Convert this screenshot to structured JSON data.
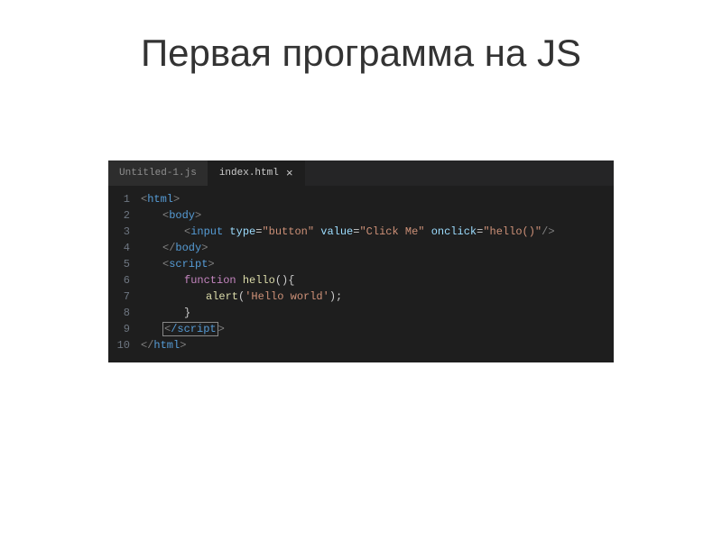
{
  "slide": {
    "title": "Первая программа на JS"
  },
  "editor": {
    "tabs": [
      {
        "label": "Untitled-1.js",
        "active": false
      },
      {
        "label": "index.html",
        "active": true
      }
    ],
    "close_glyph": "×",
    "line_numbers": [
      "1",
      "2",
      "3",
      "4",
      "5",
      "6",
      "7",
      "8",
      "9",
      "10"
    ],
    "code": {
      "l1": {
        "open": "<",
        "tag": "html",
        "close": ">"
      },
      "l2": {
        "open": "<",
        "tag": "body",
        "close": ">"
      },
      "l3": {
        "open": "<",
        "tag": "input",
        "attr1": "type",
        "val1": "\"button\"",
        "attr2": "value",
        "val2": "\"Click Me\"",
        "attr3": "onclick",
        "val3": "\"hello()\"",
        "close": "/>"
      },
      "l4": {
        "open": "</",
        "tag": "body",
        "close": ">"
      },
      "l5": {
        "open": "<",
        "tag": "script",
        "close": ">"
      },
      "l6": {
        "kw": "function",
        "fn": "hello",
        "rest": "(){"
      },
      "l7": {
        "fn": "alert",
        "paren_open": "(",
        "str": "'Hello world'",
        "paren_close": ");"
      },
      "l8": {
        "brace": "}"
      },
      "l9": {
        "open": "<",
        "slash_tag": "/script",
        "close": ">"
      },
      "l10": {
        "open": "</",
        "tag": "html",
        "close": ">"
      }
    }
  }
}
